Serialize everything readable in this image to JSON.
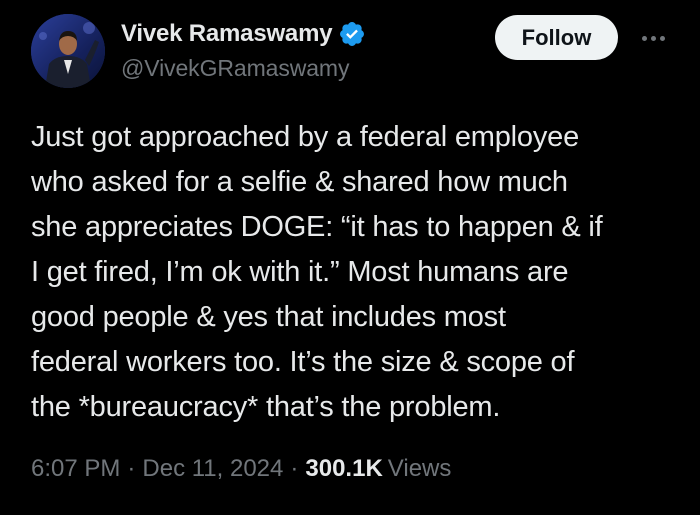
{
  "author": {
    "display_name": "Vivek Ramaswamy",
    "handle": "@VivekGRamaswamy",
    "verified": true,
    "verified_color": "#1d9bf0",
    "avatar_icon": "profile-photo"
  },
  "actions": {
    "follow_label": "Follow",
    "more_icon": "more-horizontal-icon"
  },
  "tweet": {
    "text_lines": [
      "Just got approached by a federal employee",
      "who asked for a selfie & shared how much",
      "she appreciates DOGE: “it has to happen & if",
      "I get fired, I’m ok with it.” Most humans are",
      "good people & yes that includes most",
      "federal workers too. It’s the size & scope of",
      "the *bureaucracy* that’s the problem."
    ]
  },
  "meta": {
    "time": "6:07 PM",
    "separator": "·",
    "date": "Dec 11, 2024",
    "views_count": "300.1K",
    "views_label": "Views"
  },
  "colors": {
    "background": "#000000",
    "primary_text": "#e7e9ea",
    "secondary_text": "#71767b",
    "follow_bg": "#eff3f4"
  }
}
